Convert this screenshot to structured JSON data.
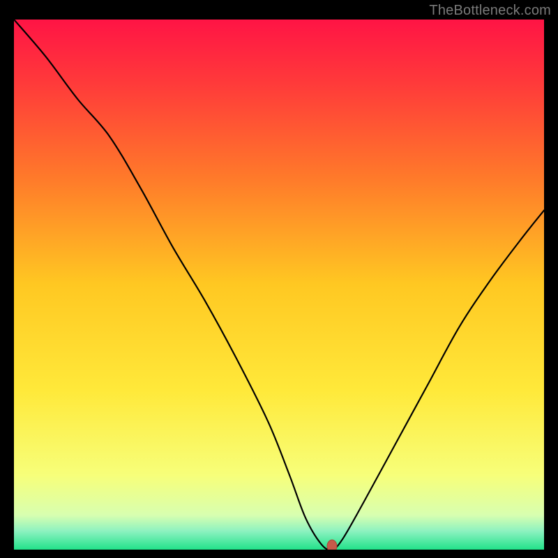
{
  "watermark": "TheBottleneck.com",
  "colors": {
    "frame": "#000000",
    "watermark": "#7a7a7a",
    "gradient_stops": [
      {
        "offset": 0.0,
        "color": "#ff1445"
      },
      {
        "offset": 0.12,
        "color": "#ff3a3a"
      },
      {
        "offset": 0.3,
        "color": "#ff7a2a"
      },
      {
        "offset": 0.5,
        "color": "#ffc822"
      },
      {
        "offset": 0.7,
        "color": "#ffe93a"
      },
      {
        "offset": 0.86,
        "color": "#f7ff7a"
      },
      {
        "offset": 0.935,
        "color": "#d8ffb0"
      },
      {
        "offset": 0.965,
        "color": "#8df2c0"
      },
      {
        "offset": 1.0,
        "color": "#22e28a"
      }
    ],
    "curve": "#000000",
    "marker_fill": "#c65a4a",
    "marker_stroke": "#a84838"
  },
  "chart_data": {
    "type": "line",
    "title": "",
    "xlabel": "",
    "ylabel": "",
    "xlim": [
      0,
      100
    ],
    "ylim": [
      0,
      100
    ],
    "grid": false,
    "legend": false,
    "series": [
      {
        "name": "bottleneck-curve",
        "x": [
          0,
          6,
          12,
          18,
          24,
          30,
          36,
          42,
          48,
          52,
          55,
          58,
          60,
          62,
          66,
          72,
          78,
          84,
          90,
          96,
          100
        ],
        "values": [
          100,
          93,
          85,
          78,
          68,
          57,
          47,
          36,
          24,
          14,
          6,
          1,
          0,
          2,
          9,
          20,
          31,
          42,
          51,
          59,
          64
        ]
      }
    ],
    "marker": {
      "x": 60,
      "y": 0
    }
  }
}
